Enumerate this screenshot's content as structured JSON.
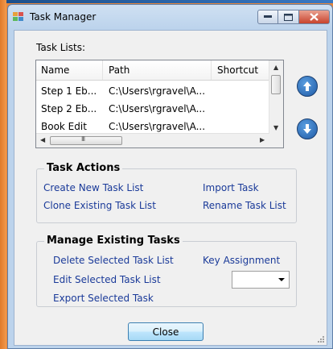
{
  "window": {
    "title": "Task Manager"
  },
  "task_lists": {
    "label": "Task Lists:",
    "columns": [
      "Name",
      "Path",
      "Shortcut"
    ],
    "rows": [
      {
        "name": "Step 1 Eb...",
        "path": "C:\\Users\\rgravel\\A...",
        "shortcut": ""
      },
      {
        "name": "Step 2 Eb...",
        "path": "C:\\Users\\rgravel\\A...",
        "shortcut": ""
      },
      {
        "name": "Book Edit",
        "path": "C:\\Users\\rgravel\\A...",
        "shortcut": ""
      }
    ],
    "hscroll_glyph": "III"
  },
  "task_actions": {
    "title": "Task Actions",
    "create_new": "Create New Task List",
    "import": "Import Task",
    "clone": "Clone Existing Task List",
    "rename": "Rename Task List"
  },
  "manage_tasks": {
    "title": "Manage Existing Tasks",
    "delete": "Delete Selected Task List",
    "key_assignment": "Key Assignment",
    "edit": "Edit Selected Task List",
    "export": "Export Selected Task",
    "key_combo_value": ""
  },
  "buttons": {
    "close": "Close"
  },
  "icons": {
    "move_up": "arrow-up-icon",
    "move_down": "arrow-down-icon",
    "app": "task-manager-app-icon"
  },
  "colors": {
    "link": "#1a3a99",
    "accent_button": "#1f5aa6",
    "close_caption": "#c8432d"
  }
}
